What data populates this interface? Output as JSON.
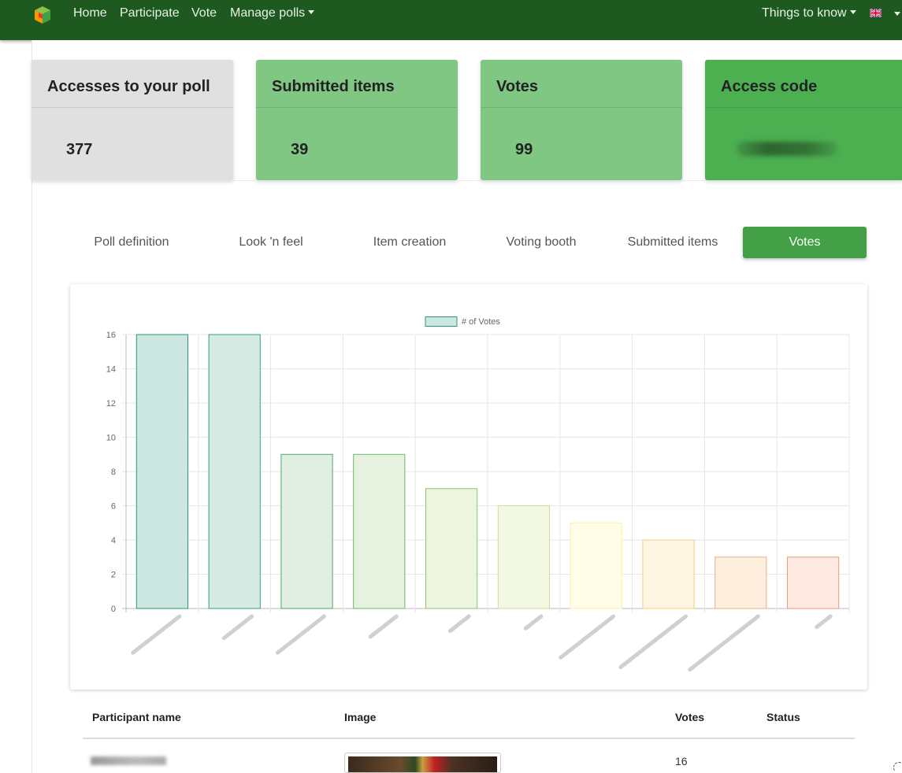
{
  "navbar": {
    "logo_icon": "cube-logo-icon",
    "links": [
      "Home",
      "Participate",
      "Vote"
    ],
    "manage_polls": "Manage polls",
    "things_to_know": "Things to know",
    "language_icon": "uk-flag-icon"
  },
  "cards": [
    {
      "title": "Accesses to your poll",
      "value": "377",
      "color": "#e0e0e0"
    },
    {
      "title": "Submitted items",
      "value": "39",
      "color": "#81c784"
    },
    {
      "title": "Votes",
      "value": "99",
      "color": "#81c784"
    },
    {
      "title": "Access code",
      "value": "",
      "color": "#4caf50"
    }
  ],
  "tabs": [
    "Poll definition",
    "Look 'n feel",
    "Item creation",
    "Voting booth",
    "Submitted items",
    "Votes"
  ],
  "active_tab": "Votes",
  "chart_data": {
    "type": "bar",
    "legend": "# of Votes",
    "legend_position": "top",
    "values": [
      16,
      16,
      9,
      9,
      7,
      6,
      5,
      4,
      3,
      3
    ],
    "ylim": [
      0,
      16
    ],
    "yticks": [
      0,
      2,
      4,
      6,
      8,
      10,
      12,
      14,
      16
    ],
    "grid": true,
    "category_labels_obscured": true,
    "fill_colors": [
      "#cce6e0",
      "#d6ebe3",
      "#e1efe2",
      "#e6f2df",
      "#edf5e0",
      "#f3f8e4",
      "#fffde6",
      "#fff6e2",
      "#fdeedd",
      "#fde9df"
    ],
    "border_colors": [
      "#2a9680",
      "#3a9f7c",
      "#4fa46c",
      "#6db56a",
      "#8cc46c",
      "#c9e091",
      "#f7f2a8",
      "#f2cc82",
      "#efae86",
      "#ed9a7c"
    ]
  },
  "table": {
    "headers": [
      "Participant name",
      "Image",
      "Votes",
      "Status"
    ],
    "rows": [
      {
        "votes": "16",
        "status": ""
      }
    ]
  }
}
